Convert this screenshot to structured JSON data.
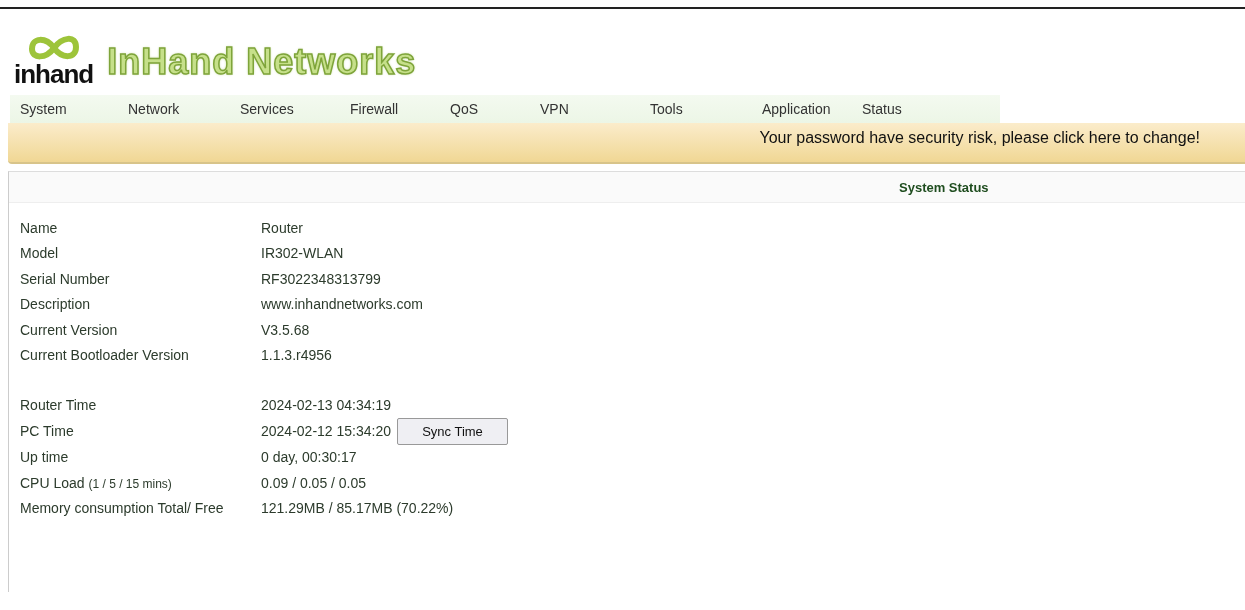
{
  "logo": {
    "mark": "inhand",
    "title": "InHand Networks"
  },
  "nav": [
    {
      "label": "System"
    },
    {
      "label": "Network"
    },
    {
      "label": "Services"
    },
    {
      "label": "Firewall"
    },
    {
      "label": "QoS"
    },
    {
      "label": "VPN"
    },
    {
      "label": "Tools"
    },
    {
      "label": "Application"
    },
    {
      "label": "Status"
    }
  ],
  "banner": "Your password have security risk, please click here to change!",
  "panel": {
    "title": "System Status",
    "sections": [
      [
        {
          "label": "Name",
          "value": "Router"
        },
        {
          "label": "Model",
          "value": "IR302-WLAN"
        },
        {
          "label": "Serial Number",
          "value": "RF3022348313799"
        },
        {
          "label": "Description",
          "value": "www.inhandnetworks.com"
        },
        {
          "label": "Current Version",
          "value": "V3.5.68"
        },
        {
          "label": "Current Bootloader Version",
          "value": "1.1.3.r4956"
        }
      ],
      [
        {
          "label": "Router Time",
          "value": "2024-02-13 04:34:19"
        },
        {
          "label": "PC Time",
          "value": "2024-02-12 15:34:20",
          "button": "Sync Time"
        },
        {
          "label": "Up time",
          "value": "0 day, 00:30:17"
        },
        {
          "label": "CPU Load",
          "note": "(1 / 5 / 15 mins)",
          "value": "0.09 / 0.05 / 0.05"
        },
        {
          "label": "Memory consumption Total/ Free",
          "value": "121.29MB / 85.17MB (70.22%)"
        }
      ]
    ]
  }
}
